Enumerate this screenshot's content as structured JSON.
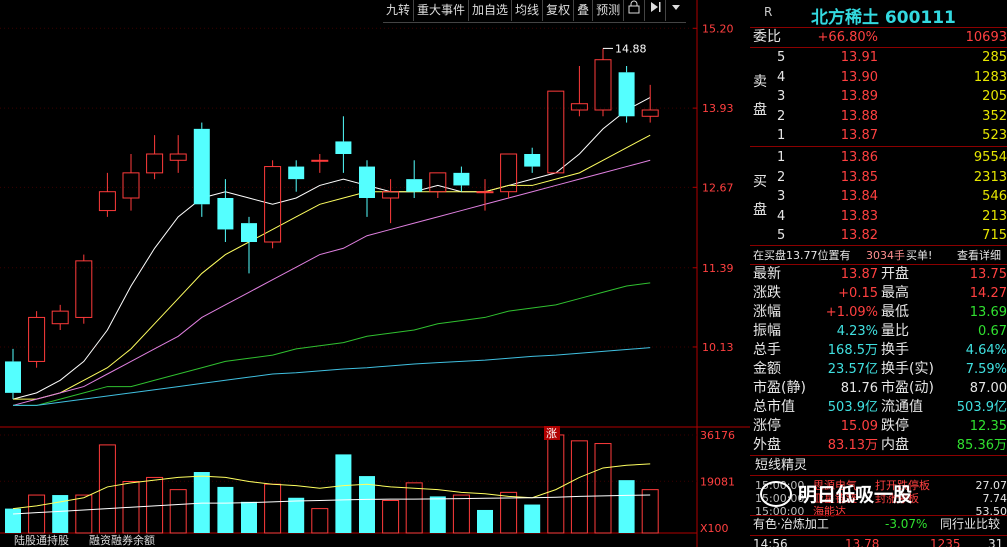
{
  "toolbar": {
    "items": [
      "九转",
      "重大事件",
      "加自选",
      "均线",
      "复权",
      "叠",
      "预测"
    ],
    "lock_icon": "lock-icon",
    "arrow_icon": "play-right-icon"
  },
  "bottom_tabs": [
    "陆股通持股",
    "融资融券余额"
  ],
  "zhang_label": "涨",
  "chart_data": {
    "type": "candlestick",
    "price_axis": {
      "ticks": [
        "15.20",
        "13.93",
        "12.67",
        "11.39",
        "10.13"
      ],
      "ylim": [
        9.0,
        15.3
      ]
    },
    "volume_axis": {
      "ticks": [
        "36176",
        "19081",
        "X100"
      ],
      "ylim": [
        0,
        38000
      ]
    },
    "peak_label": "14.88",
    "candles": [
      {
        "o": 9.9,
        "c": 9.4,
        "h": 10.1,
        "l": 9.3
      },
      {
        "o": 9.9,
        "c": 10.6,
        "h": 10.7,
        "l": 9.8
      },
      {
        "o": 10.5,
        "c": 10.7,
        "h": 10.8,
        "l": 10.4
      },
      {
        "o": 10.6,
        "c": 11.5,
        "h": 11.6,
        "l": 10.5
      },
      {
        "o": 12.3,
        "c": 12.6,
        "h": 12.9,
        "l": 12.2
      },
      {
        "o": 12.5,
        "c": 12.9,
        "h": 13.2,
        "l": 12.3
      },
      {
        "o": 12.9,
        "c": 13.2,
        "h": 13.5,
        "l": 12.8
      },
      {
        "o": 13.1,
        "c": 13.2,
        "h": 13.5,
        "l": 12.9
      },
      {
        "o": 13.6,
        "c": 12.4,
        "h": 13.7,
        "l": 12.2
      },
      {
        "o": 12.5,
        "c": 12.0,
        "h": 12.8,
        "l": 11.8
      },
      {
        "o": 12.1,
        "c": 11.8,
        "h": 12.2,
        "l": 11.3
      },
      {
        "o": 11.8,
        "c": 13.0,
        "h": 13.1,
        "l": 11.7
      },
      {
        "o": 13.0,
        "c": 12.8,
        "h": 13.1,
        "l": 12.6
      },
      {
        "o": 13.1,
        "c": 13.1,
        "h": 13.2,
        "l": 12.9
      },
      {
        "o": 13.4,
        "c": 13.2,
        "h": 13.8,
        "l": 12.9
      },
      {
        "o": 13.0,
        "c": 12.5,
        "h": 13.1,
        "l": 12.2
      },
      {
        "o": 12.5,
        "c": 12.6,
        "h": 12.8,
        "l": 12.1
      },
      {
        "o": 12.8,
        "c": 12.6,
        "h": 13.1,
        "l": 12.5
      },
      {
        "o": 12.6,
        "c": 12.9,
        "h": 12.9,
        "l": 12.5
      },
      {
        "o": 12.9,
        "c": 12.7,
        "h": 13.0,
        "l": 12.6
      },
      {
        "o": 12.6,
        "c": 12.6,
        "h": 12.8,
        "l": 12.3
      },
      {
        "o": 12.6,
        "c": 13.2,
        "h": 13.2,
        "l": 12.5
      },
      {
        "o": 13.2,
        "c": 13.0,
        "h": 13.3,
        "l": 12.9
      },
      {
        "o": 12.9,
        "c": 14.2,
        "h": 14.2,
        "l": 12.9
      },
      {
        "o": 13.9,
        "c": 14.0,
        "h": 14.6,
        "l": 13.8
      },
      {
        "o": 13.9,
        "c": 14.7,
        "h": 14.88,
        "l": 13.8
      },
      {
        "o": 14.5,
        "c": 13.8,
        "h": 14.6,
        "l": 13.7
      },
      {
        "o": 13.8,
        "c": 13.9,
        "h": 14.3,
        "l": 13.7
      }
    ],
    "volumes": [
      {
        "v": 9000,
        "up": false
      },
      {
        "v": 14000,
        "up": true
      },
      {
        "v": 14000,
        "up": false
      },
      {
        "v": 14000,
        "up": true
      },
      {
        "v": 32500,
        "up": true
      },
      {
        "v": 19000,
        "up": true
      },
      {
        "v": 20500,
        "up": true
      },
      {
        "v": 16000,
        "up": true
      },
      {
        "v": 22500,
        "up": false
      },
      {
        "v": 17000,
        "up": false
      },
      {
        "v": 11500,
        "up": false
      },
      {
        "v": 18000,
        "up": true
      },
      {
        "v": 13000,
        "up": false
      },
      {
        "v": 9000,
        "up": true
      },
      {
        "v": 29000,
        "up": false
      },
      {
        "v": 21000,
        "up": false
      },
      {
        "v": 12000,
        "up": true
      },
      {
        "v": 18500,
        "up": true
      },
      {
        "v": 13500,
        "up": false
      },
      {
        "v": 14000,
        "up": true
      },
      {
        "v": 8500,
        "up": false
      },
      {
        "v": 15000,
        "up": true
      },
      {
        "v": 10500,
        "up": false
      },
      {
        "v": 36176,
        "up": true
      },
      {
        "v": 34000,
        "up": true
      },
      {
        "v": 33000,
        "up": true
      },
      {
        "v": 19500,
        "up": false
      },
      {
        "v": 16000,
        "up": true
      }
    ],
    "ma_lines": [
      {
        "color": "#ffffff",
        "values": [
          9.3,
          9.4,
          9.6,
          9.9,
          10.4,
          11.1,
          11.7,
          12.2,
          12.5,
          12.6,
          12.5,
          12.4,
          12.5,
          12.7,
          12.8,
          12.7,
          12.6,
          12.6,
          12.7,
          12.6,
          12.6,
          12.7,
          12.8,
          12.9,
          13.2,
          13.6,
          13.9,
          14.1
        ]
      },
      {
        "color": "#ffff60",
        "values": [
          9.3,
          9.3,
          9.4,
          9.6,
          9.8,
          10.1,
          10.5,
          10.9,
          11.3,
          11.6,
          11.8,
          12.0,
          12.2,
          12.4,
          12.5,
          12.6,
          12.6,
          12.6,
          12.6,
          12.6,
          12.6,
          12.7,
          12.7,
          12.8,
          12.9,
          13.1,
          13.3,
          13.5
        ]
      },
      {
        "color": "#e080e0",
        "values": [
          9.2,
          9.3,
          9.4,
          9.5,
          9.7,
          9.9,
          10.1,
          10.3,
          10.6,
          10.8,
          11.0,
          11.2,
          11.4,
          11.6,
          11.7,
          11.9,
          12.0,
          12.1,
          12.2,
          12.3,
          12.4,
          12.5,
          12.6,
          12.7,
          12.8,
          12.9,
          13.0,
          13.1
        ]
      },
      {
        "color": "#30c030",
        "values": [
          9.2,
          9.2,
          9.3,
          9.4,
          9.5,
          9.5,
          9.6,
          9.7,
          9.8,
          9.9,
          9.95,
          10.0,
          10.1,
          10.15,
          10.2,
          10.3,
          10.35,
          10.4,
          10.5,
          10.55,
          10.6,
          10.7,
          10.75,
          10.8,
          10.9,
          11.0,
          11.1,
          11.15
        ]
      },
      {
        "color": "#40c0e0",
        "values": [
          9.2,
          9.2,
          9.25,
          9.3,
          9.35,
          9.4,
          9.45,
          9.5,
          9.55,
          9.6,
          9.65,
          9.7,
          9.72,
          9.75,
          9.78,
          9.8,
          9.83,
          9.86,
          9.88,
          9.9,
          9.92,
          9.95,
          9.98,
          10.0,
          10.03,
          10.06,
          10.09,
          10.12
        ]
      }
    ],
    "vol_ma": [
      {
        "color": "#ffff60",
        "values": [
          9000,
          10000,
          11500,
          13000,
          17000,
          18500,
          19500,
          20500,
          21000,
          20500,
          19000,
          18000,
          17500,
          16500,
          17500,
          18000,
          17000,
          16500,
          16000,
          15000,
          14500,
          13500,
          13000,
          16000,
          20500,
          24000,
          25000,
          25500
        ]
      },
      {
        "color": "#ffffff",
        "values": [
          7000,
          7500,
          8000,
          8500,
          9000,
          9500,
          10000,
          10500,
          11000,
          11000,
          11200,
          11500,
          11800,
          12000,
          12200,
          12400,
          12500,
          12500,
          12600,
          12700,
          12800,
          12900,
          13000,
          13200,
          13500,
          13700,
          13900,
          14000
        ]
      }
    ]
  },
  "quote": {
    "r_label": "R",
    "title": "北方稀土 600111",
    "weibi_label": "委比",
    "weibi_pct": "+66.80%",
    "weibi_val": "10693",
    "sell_side": "卖盘",
    "buy_side": "买盘",
    "asks": [
      {
        "lvl": "5",
        "price": "13.91",
        "vol": "285"
      },
      {
        "lvl": "4",
        "price": "13.90",
        "vol": "1283"
      },
      {
        "lvl": "3",
        "price": "13.89",
        "vol": "205"
      },
      {
        "lvl": "2",
        "price": "13.88",
        "vol": "352"
      },
      {
        "lvl": "1",
        "price": "13.87",
        "vol": "523"
      }
    ],
    "bids": [
      {
        "lvl": "1",
        "price": "13.86",
        "vol": "9554"
      },
      {
        "lvl": "2",
        "price": "13.85",
        "vol": "2313"
      },
      {
        "lvl": "3",
        "price": "13.84",
        "vol": "546"
      },
      {
        "lvl": "4",
        "price": "13.83",
        "vol": "213"
      },
      {
        "lvl": "5",
        "price": "13.82",
        "vol": "715"
      }
    ],
    "notice_left": "在买盘13.77位置有",
    "notice_vol": "3034手",
    "notice_tag": "买单!",
    "notice_link": "查看详细",
    "stats": [
      {
        "l1": "最新",
        "v1": "13.87",
        "c1": "red",
        "l2": "开盘",
        "v2": "13.75",
        "c2": "red"
      },
      {
        "l1": "涨跌",
        "v1": "+0.15",
        "c1": "red",
        "l2": "最高",
        "v2": "14.27",
        "c2": "red"
      },
      {
        "l1": "涨幅",
        "v1": "+1.09%",
        "c1": "red",
        "l2": "最低",
        "v2": "13.69",
        "c2": "green"
      },
      {
        "l1": "振幅",
        "v1": "4.23%",
        "c1": "cyan",
        "l2": "量比",
        "v2": "0.67",
        "c2": "green"
      },
      {
        "l1": "总手",
        "v1": "168.5万",
        "c1": "cyan",
        "l2": "换手",
        "v2": "4.64%",
        "c2": "cyan"
      },
      {
        "l1": "金额",
        "v1": "23.57亿",
        "c1": "cyan",
        "l2": "换手(实)",
        "v2": "7.59%",
        "c2": "cyan"
      },
      {
        "l1": "市盈(静)",
        "v1": "81.76",
        "c1": "white",
        "l2": "市盈(动)",
        "v2": "87.00",
        "c2": "white"
      },
      {
        "l1": "总市值",
        "v1": "503.9亿",
        "c1": "cyan",
        "l2": "流通值",
        "v2": "503.9亿",
        "c2": "cyan"
      },
      {
        "l1": "涨停",
        "v1": "15.09",
        "c1": "red",
        "l2": "跌停",
        "v2": "12.35",
        "c2": "green"
      },
      {
        "l1": "外盘",
        "v1": "83.13万",
        "c1": "red",
        "l2": "内盘",
        "v2": "85.36万",
        "c2": "green"
      }
    ],
    "spirit_title": "短线精灵",
    "spirit_rows": [
      {
        "time": "15:00:00",
        "name": "思源电气",
        "event": "打开跌停板",
        "val": "27.07"
      },
      {
        "time": "15:00:00",
        "name": "亚星锚链",
        "event": "封涨停板",
        "val": "7.74"
      },
      {
        "time": "15:00:00",
        "name": "海能达",
        "event": "",
        "val": "53.50"
      }
    ],
    "sector_name": "有色·冶炼加工",
    "sector_pct": "-3.07%",
    "sector_link": "同行业比较",
    "last_time": "14:56",
    "last_price": "13.78",
    "last_vol": "1235",
    "last_extra": "31"
  },
  "watermark": {
    "text": "明日低吸一股",
    "icon": "wechat-icon"
  }
}
